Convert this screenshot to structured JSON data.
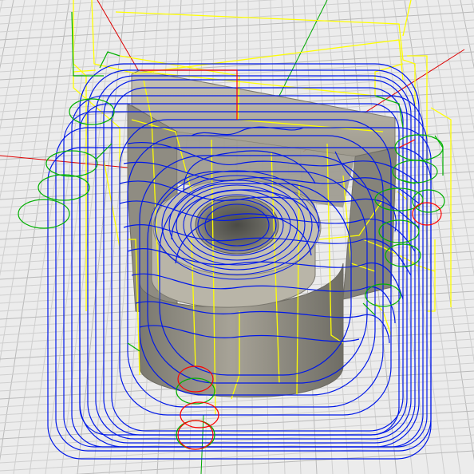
{
  "viewport": {
    "view": "cam-toolpath-3d-view",
    "background": "#ececec",
    "grid": {
      "shown": true,
      "minor_color": "#cfcfcf",
      "major_color": "#b9b9b9"
    },
    "axes": {
      "x_color": "#dd0000",
      "y_color": "#00aa00"
    },
    "model": {
      "body_color": "#8c8a82",
      "top_color": "#b0aca0",
      "highlight": "#d4d0c4"
    },
    "toolpaths": {
      "cutting_color": "#0018e8",
      "rapid_color": "#ffff00",
      "lead_color": "#00b000",
      "arc_color": "#ff0000"
    }
  }
}
